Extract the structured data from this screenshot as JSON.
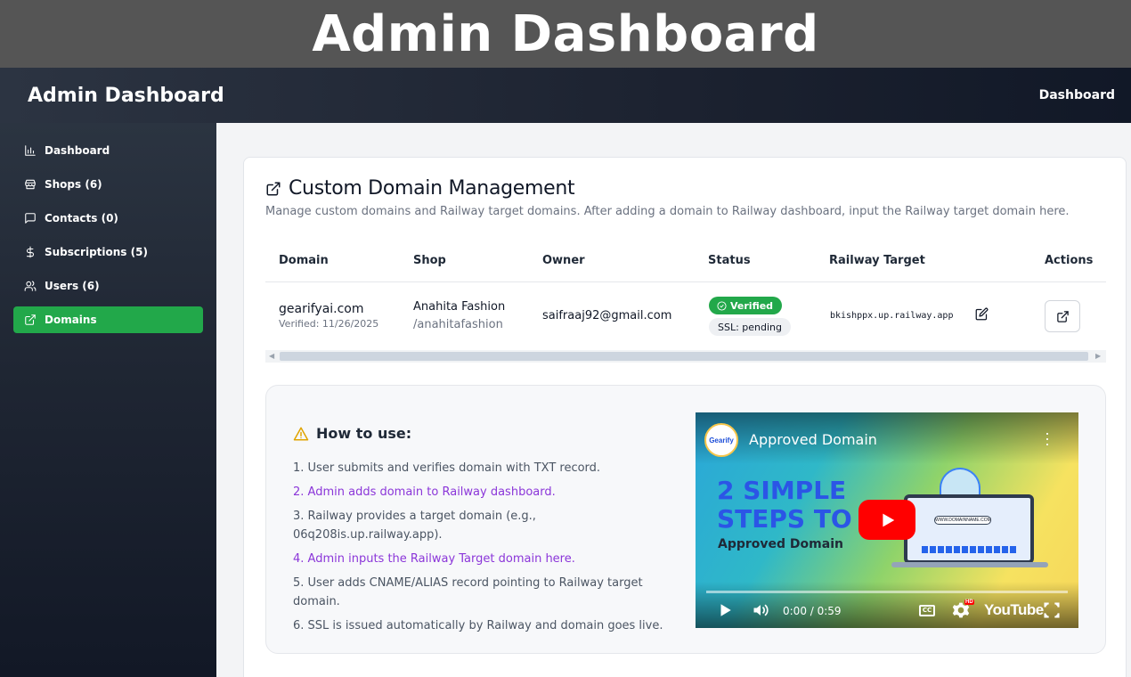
{
  "banner": {
    "title": "Admin Dashboard"
  },
  "topbar": {
    "brand": "Admin Dashboard",
    "link": "Dashboard"
  },
  "sidebar": {
    "items": [
      {
        "label": "Dashboard",
        "icon": "bar-chart-icon",
        "active": false
      },
      {
        "label": "Shops (6)",
        "icon": "store-icon",
        "active": false
      },
      {
        "label": "Contacts (0)",
        "icon": "message-square-icon",
        "active": false
      },
      {
        "label": "Subscriptions (5)",
        "icon": "dollar-icon",
        "active": false
      },
      {
        "label": "Users (6)",
        "icon": "users-icon",
        "active": false
      },
      {
        "label": "Domains",
        "icon": "external-link-icon",
        "active": true
      }
    ],
    "active_color": "#22a84a"
  },
  "card": {
    "title": "Custom Domain Management",
    "subtitle": "Manage custom domains and Railway target domains. After adding a domain to Railway dashboard, input the Railway target domain here.",
    "columns": [
      "Domain",
      "Shop",
      "Owner",
      "Status",
      "Railway Target",
      "Actions"
    ],
    "rows": [
      {
        "domain": "gearifyai.com",
        "verified_date": "Verified: 11/26/2025",
        "shop_name": "Anahita Fashion",
        "shop_slug": "/anahitafashion",
        "owner": "saifraaj92@gmail.com",
        "status": "Verified",
        "ssl": "SSL: pending",
        "railway_target": "bkishppx.up.railway.app"
      }
    ]
  },
  "howto": {
    "title": "How to use:",
    "steps": [
      "1. User submits and verifies domain with TXT record.",
      "2. Admin adds domain to Railway dashboard.",
      "3. Railway provides a target domain (e.g., 06q208is.up.railway.app).",
      "4. Admin inputs the Railway Target domain here.",
      "5. User adds CNAME/ALIAS record pointing to Railway target domain.",
      "6. SSL is issued automatically by Railway and domain goes live."
    ]
  },
  "video": {
    "title": "Approved Domain",
    "channel": "Gearify",
    "headline_1": "2 SIMPLE",
    "headline_2": "STEPS TO",
    "headline_3": "Approved Domain",
    "url_text": "WWW.DOMAINNAME.COM",
    "time": "0:00 / 0:59",
    "cc": "CC",
    "hd": "HD",
    "brand": "YouTube"
  },
  "colors": {
    "accent": "#22a84a",
    "highlight": "#8b36d9",
    "youtube_red": "#ff0000"
  }
}
